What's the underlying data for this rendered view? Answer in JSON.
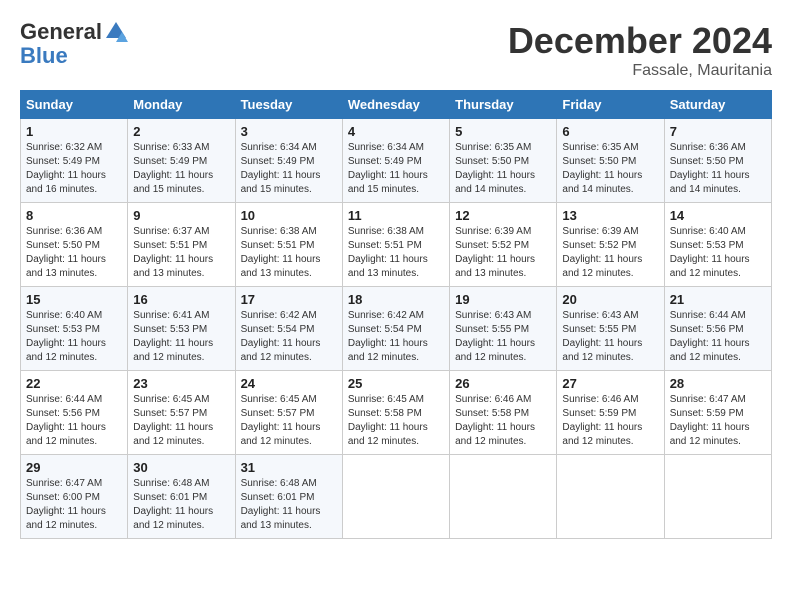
{
  "header": {
    "logo_general": "General",
    "logo_blue": "Blue",
    "month": "December 2024",
    "location": "Fassale, Mauritania"
  },
  "weekdays": [
    "Sunday",
    "Monday",
    "Tuesday",
    "Wednesday",
    "Thursday",
    "Friday",
    "Saturday"
  ],
  "weeks": [
    [
      {
        "day": "1",
        "info": "Sunrise: 6:32 AM\nSunset: 5:49 PM\nDaylight: 11 hours and 16 minutes."
      },
      {
        "day": "2",
        "info": "Sunrise: 6:33 AM\nSunset: 5:49 PM\nDaylight: 11 hours and 15 minutes."
      },
      {
        "day": "3",
        "info": "Sunrise: 6:34 AM\nSunset: 5:49 PM\nDaylight: 11 hours and 15 minutes."
      },
      {
        "day": "4",
        "info": "Sunrise: 6:34 AM\nSunset: 5:49 PM\nDaylight: 11 hours and 15 minutes."
      },
      {
        "day": "5",
        "info": "Sunrise: 6:35 AM\nSunset: 5:50 PM\nDaylight: 11 hours and 14 minutes."
      },
      {
        "day": "6",
        "info": "Sunrise: 6:35 AM\nSunset: 5:50 PM\nDaylight: 11 hours and 14 minutes."
      },
      {
        "day": "7",
        "info": "Sunrise: 6:36 AM\nSunset: 5:50 PM\nDaylight: 11 hours and 14 minutes."
      }
    ],
    [
      {
        "day": "8",
        "info": "Sunrise: 6:36 AM\nSunset: 5:50 PM\nDaylight: 11 hours and 13 minutes."
      },
      {
        "day": "9",
        "info": "Sunrise: 6:37 AM\nSunset: 5:51 PM\nDaylight: 11 hours and 13 minutes."
      },
      {
        "day": "10",
        "info": "Sunrise: 6:38 AM\nSunset: 5:51 PM\nDaylight: 11 hours and 13 minutes."
      },
      {
        "day": "11",
        "info": "Sunrise: 6:38 AM\nSunset: 5:51 PM\nDaylight: 11 hours and 13 minutes."
      },
      {
        "day": "12",
        "info": "Sunrise: 6:39 AM\nSunset: 5:52 PM\nDaylight: 11 hours and 13 minutes."
      },
      {
        "day": "13",
        "info": "Sunrise: 6:39 AM\nSunset: 5:52 PM\nDaylight: 11 hours and 12 minutes."
      },
      {
        "day": "14",
        "info": "Sunrise: 6:40 AM\nSunset: 5:53 PM\nDaylight: 11 hours and 12 minutes."
      }
    ],
    [
      {
        "day": "15",
        "info": "Sunrise: 6:40 AM\nSunset: 5:53 PM\nDaylight: 11 hours and 12 minutes."
      },
      {
        "day": "16",
        "info": "Sunrise: 6:41 AM\nSunset: 5:53 PM\nDaylight: 11 hours and 12 minutes."
      },
      {
        "day": "17",
        "info": "Sunrise: 6:42 AM\nSunset: 5:54 PM\nDaylight: 11 hours and 12 minutes."
      },
      {
        "day": "18",
        "info": "Sunrise: 6:42 AM\nSunset: 5:54 PM\nDaylight: 11 hours and 12 minutes."
      },
      {
        "day": "19",
        "info": "Sunrise: 6:43 AM\nSunset: 5:55 PM\nDaylight: 11 hours and 12 minutes."
      },
      {
        "day": "20",
        "info": "Sunrise: 6:43 AM\nSunset: 5:55 PM\nDaylight: 11 hours and 12 minutes."
      },
      {
        "day": "21",
        "info": "Sunrise: 6:44 AM\nSunset: 5:56 PM\nDaylight: 11 hours and 12 minutes."
      }
    ],
    [
      {
        "day": "22",
        "info": "Sunrise: 6:44 AM\nSunset: 5:56 PM\nDaylight: 11 hours and 12 minutes."
      },
      {
        "day": "23",
        "info": "Sunrise: 6:45 AM\nSunset: 5:57 PM\nDaylight: 11 hours and 12 minutes."
      },
      {
        "day": "24",
        "info": "Sunrise: 6:45 AM\nSunset: 5:57 PM\nDaylight: 11 hours and 12 minutes."
      },
      {
        "day": "25",
        "info": "Sunrise: 6:45 AM\nSunset: 5:58 PM\nDaylight: 11 hours and 12 minutes."
      },
      {
        "day": "26",
        "info": "Sunrise: 6:46 AM\nSunset: 5:58 PM\nDaylight: 11 hours and 12 minutes."
      },
      {
        "day": "27",
        "info": "Sunrise: 6:46 AM\nSunset: 5:59 PM\nDaylight: 11 hours and 12 minutes."
      },
      {
        "day": "28",
        "info": "Sunrise: 6:47 AM\nSunset: 5:59 PM\nDaylight: 11 hours and 12 minutes."
      }
    ],
    [
      {
        "day": "29",
        "info": "Sunrise: 6:47 AM\nSunset: 6:00 PM\nDaylight: 11 hours and 12 minutes."
      },
      {
        "day": "30",
        "info": "Sunrise: 6:48 AM\nSunset: 6:01 PM\nDaylight: 11 hours and 12 minutes."
      },
      {
        "day": "31",
        "info": "Sunrise: 6:48 AM\nSunset: 6:01 PM\nDaylight: 11 hours and 13 minutes."
      },
      null,
      null,
      null,
      null
    ]
  ]
}
